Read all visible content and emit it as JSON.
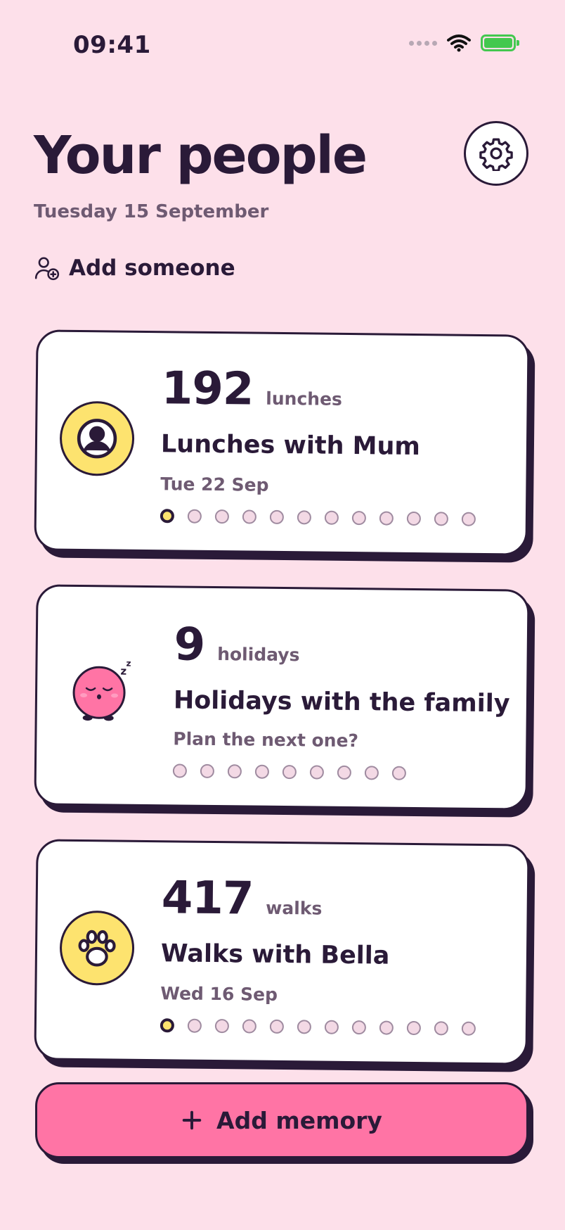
{
  "status": {
    "time": "09:41"
  },
  "header": {
    "title": "Your people",
    "date": "Tuesday 15 September",
    "add_someone_label": "Add someone"
  },
  "cards": [
    {
      "count": "192",
      "unit": "lunches",
      "title": "Lunches with Mum",
      "subtitle": "Tue 22 Sep",
      "avatar": "person-icon",
      "avatar_color": "#fde36f",
      "dots_total": 12,
      "dots_filled": 1
    },
    {
      "count": "9",
      "unit": "holidays",
      "title": "Holidays with the family",
      "subtitle": "Plan the next one?",
      "avatar": "sleeping-blob-icon",
      "avatar_color": "#ff74a5",
      "dots_total": 9,
      "dots_filled": 0
    },
    {
      "count": "417",
      "unit": "walks",
      "title": "Walks with Bella",
      "subtitle": "Wed 16 Sep",
      "avatar": "paw-icon",
      "avatar_color": "#fde36f",
      "dots_total": 12,
      "dots_filled": 1
    }
  ],
  "add_memory_label": "Add memory",
  "colors": {
    "background": "#fde0ea",
    "accent": "#ff74a5",
    "yellow": "#fde36f",
    "ink": "#2a1a38"
  }
}
